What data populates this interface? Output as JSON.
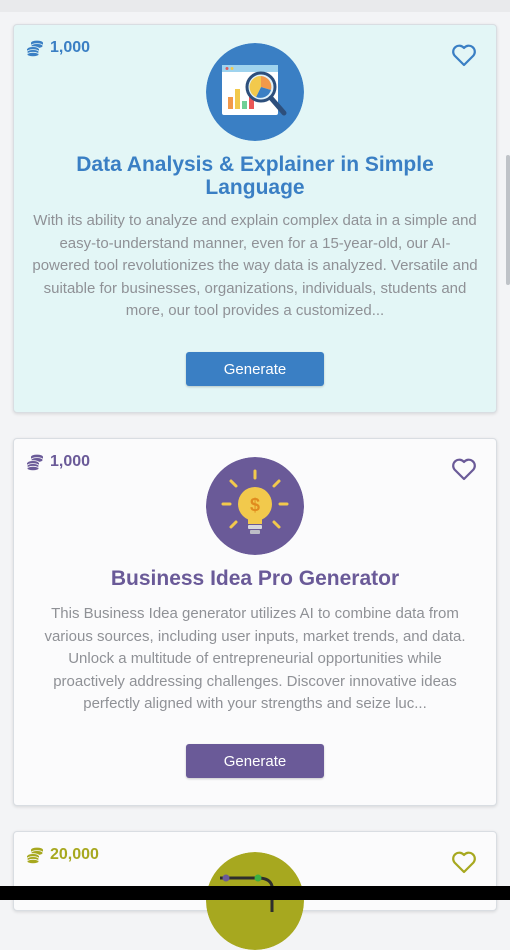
{
  "colors": {
    "blue": "#3a7fc4",
    "purple": "#6a5a98",
    "olive": "#a7a81f",
    "card_teal_bg": "#e3f6f6"
  },
  "cards": [
    {
      "coins": "1,000",
      "icon": "data-analysis-magnifier-icon",
      "title": "Data Analysis & Explainer in Simple Language",
      "description": "With its ability to analyze and explain complex data in a simple and easy-to-understand manner, even for a 15-year-old, our AI-powered tool revolutionizes the way data is analyzed. Versatile and suitable for businesses, organizations, individuals, students and more, our tool provides a customized...",
      "button": "Generate"
    },
    {
      "coins": "1,000",
      "icon": "lightbulb-dollar-icon",
      "title": "Business Idea Pro Generator",
      "description": "This Business Idea generator utilizes AI to combine data from various sources, including user inputs, market trends, and data. Unlock a multitude of entrepreneurial opportunities while proactively addressing challenges. Discover innovative ideas perfectly aligned with your strengths and seize luc...",
      "button": "Generate"
    },
    {
      "coins": "20,000",
      "icon": "route-path-icon"
    }
  ]
}
